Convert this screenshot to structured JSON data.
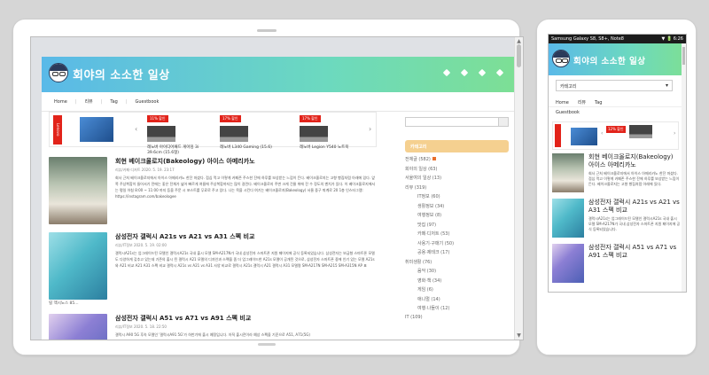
{
  "site": {
    "title": "회야의 소소한 일상",
    "nav": [
      "Home",
      "리뷰",
      "Tag",
      "Guestbook"
    ]
  },
  "ad": {
    "brand": "Lenovo",
    "products": [
      {
        "sale": "11% 할인",
        "name": "레노버 아이디어패드 게이밍 3i 39.6cm (15.6형)"
      },
      {
        "sale": "17% 할인",
        "name": "레노버 L340 Gaming (15.6)"
      },
      {
        "sale": "17% 할인",
        "name": "레노버 Legion Y540 노트북"
      }
    ]
  },
  "posts": [
    {
      "title": "회현 베이크올로지(Bakeology) 아이스 아메리카노",
      "meta": "리뷰/카페·디저트   2020. 5. 19. 23:17",
      "excerpt": "회사 근처 베이크올로지에서 아이스 아메리카노 한잔 마셨다. 점심 먹고 이렇게 카페존 주스한 잔에 하루를 보상받는 느낌이 든다. 베이크올로지는 고향 빵집처럼 아래에 있다. 앞쪽 주상복합이 들어서기 전에는 좋은 전체가 넓어 빠르게 여름에 주상복합까지는 많이 걸린다. 베이크올로지 주변 크게 건물 위에 잔 수 정도의 벤치가 있다. 이 베이크올로지에서는 평일 아침 8:00 ~ 11:00 까지 등을 주문 시 포스트를 무료로 주고 있다. 나는 목을 시킨다 여기는 베이크올로지(Bakeology) 서울 중구 퇴계로 20 1층 인스타그램: https://instagram.com/bakeologee"
    },
    {
      "title": "삼성전자 갤럭시 A21s vs A21 vs A31 스펙 비교",
      "meta": "리뷰/IT정보   2020. 5. 19. 02:00",
      "excerpt": "갤럭시A21s는 업그레이드된 모델인 갤럭시A21s 국내 출시 모델 SM-A217N가 국내 삼성전자 스마트폰 지원 페이지에 공식 등록되었습니다. 삼성전자는 보급형 스마트폰 모델도 다양하게 갖추고 있는데 기존의 출시 된 갤럭시 A21 모델의 디자인과 스펙을 좀 더 업그레이드한 A21s 모델이 공개된 것으로, 삼성전자 스마트폰 중에 인기 있는 모델 A21s와 A21 비교 A21 A31 스펙 비교 갤럭시 A21s vs A21 vs A31 사양 비교로 갤럭시 A21s 갤럭시 A21 갤럭시 A31 모델명 SM-A217N SM-A215 SM-A315N AP 표",
      "more": "릴 액시노스 85..."
    },
    {
      "title": "삼성전자 갤럭시 A51 vs A71 vs A91 스펙 비교",
      "meta": "리뷰/IT정보   2020. 5. 18. 22:50",
      "excerpt": "갤럭시 A90 5G 후속 모델인 '갤럭시A91 5G'가 하반기에 출시 예정입니다. 아직 출시전이라 예상 스펙을 기준으로 A51, A71(5G)"
    }
  ],
  "sidebar": {
    "category_header": "카테고리",
    "categories": [
      {
        "label": "전체글 (582)",
        "level": 1,
        "new": true
      },
      {
        "label": "회야의 일상 (63)",
        "level": 1
      },
      {
        "label": "서울여의 일상 (13)",
        "level": 1
      },
      {
        "label": "리뷰 (319)",
        "level": 1
      },
      {
        "label": "IT정보 (60)",
        "level": 2
      },
      {
        "label": "생활정보 (34)",
        "level": 2
      },
      {
        "label": "여행정보 (8)",
        "level": 2
      },
      {
        "label": "맛집 (97)",
        "level": 2
      },
      {
        "label": "카페·디저트 (53)",
        "level": 2
      },
      {
        "label": "사용기·구매기 (50)",
        "level": 2
      },
      {
        "label": "공용·제테크 (17)",
        "level": 2
      },
      {
        "label": "취미생활 (76)",
        "level": 1
      },
      {
        "label": "음악 (30)",
        "level": 2
      },
      {
        "label": "영화·책 (34)",
        "level": 2
      },
      {
        "label": "게임 (6)",
        "level": 2
      },
      {
        "label": "애니멀 (14)",
        "level": 2
      },
      {
        "label": "여행·나들이 (12)",
        "level": 2
      },
      {
        "label": "IT (109)",
        "level": 1
      }
    ]
  },
  "phone": {
    "status_title": "Samsung Galaxy S8, S8+, Note8",
    "status_right": "▼ 🔋 6:26",
    "select_label": "카테고리",
    "nav_row1": [
      "Home",
      "리뷰",
      "Tag"
    ],
    "nav_row2": "Guestbook",
    "ad_sale": "12% 할인",
    "posts": [
      {
        "title": "회현 베이크올로지(Bakeology) 아이스 아메리카노",
        "excerpt": "회사 근처 베이크올로지에서 아이스 아메리카노 한잔 마셨다. 점심 먹고 이렇게 카페존 주스한 잔에 하루를 보상받는 느낌이 든다. 베이크올로지는 고향 빵집처럼 아래에 있다."
      },
      {
        "title": "삼성전자 갤럭시 A21s vs A21 vs A31 스펙 비교",
        "excerpt": "갤럭시A21s는 업그레이드된 모델인 갤럭시A21s 국내 출시 모델 SM-A217N가 국내 삼성전자 스마트폰 지원 페이지에 공식 등록되었습니다."
      },
      {
        "title": "삼성전자 갤럭시 A51 vs A71 vs A91 스펙 비교",
        "excerpt": ""
      }
    ]
  }
}
